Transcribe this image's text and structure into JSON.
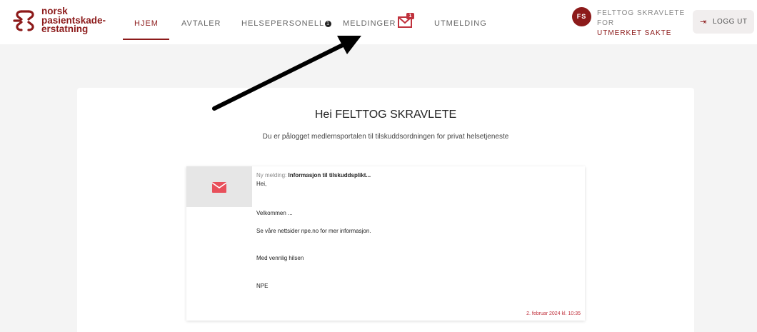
{
  "logo": {
    "line1": "norsk",
    "line2": "pasientskade-",
    "line3": "erstatning",
    "icon": "npe-logo-icon"
  },
  "nav": {
    "items": [
      {
        "label": "HJEM",
        "active": true
      },
      {
        "label": "AVTALER"
      },
      {
        "label": "HELSEPERSONELL",
        "badge": "1"
      },
      {
        "label": "MELDINGER",
        "mail_count": "1"
      },
      {
        "label": "UTMELDING"
      }
    ]
  },
  "user": {
    "initials": "FS",
    "name": "FELTTOG SKRAVLETE",
    "for": "FOR",
    "org": "UTMERKET SAKTE"
  },
  "logout": {
    "label": "LOGG UT",
    "icon": "logout-icon"
  },
  "main": {
    "greeting": "Hei FELTTOG SKRAVLETE",
    "subtitle": "Du er pålogget medlemsportalen til tilskuddsordningen for privat helsetjeneste"
  },
  "message": {
    "prefix": "Ny melding:",
    "title": "Informasjon til tilskuddsplikt...",
    "lines": [
      "Hei,",
      "Velkommen ...",
      "Se våre nettsider npe.no for mer informasjon.",
      "Med vennlig hilsen",
      "NPE"
    ],
    "date": "2. februar 2024 kl. 10:35",
    "icon": "envelope-icon"
  },
  "colors": {
    "brand": "#8c1a1a",
    "accent_red": "#c0323d"
  }
}
